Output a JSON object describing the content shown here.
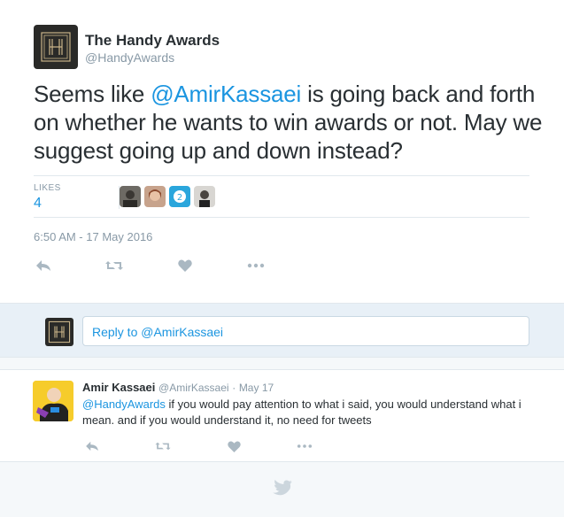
{
  "tweet": {
    "author_name": "The Handy Awards",
    "author_handle": "@HandyAwards",
    "text_before": "Seems like ",
    "text_mention": "@AmirKassaei",
    "text_after": " is going back and forth on whether he wants to win awards or not. May we suggest going up and down instead?",
    "likes_label": "LIKES",
    "likes_count": "4",
    "timestamp": "6:50 AM - 17 May 2016"
  },
  "reply_box": {
    "placeholder": "Reply to @AmirKassaei"
  },
  "reply": {
    "name": "Amir Kassaei",
    "handle": "@AmirKassaei",
    "separator": "·",
    "date": "May 17",
    "mention": "@HandyAwards",
    "text": " if you would pay attention to what i said, you would understand what i mean. and if you would understand it, no need for tweets"
  },
  "icons": {
    "reply": "reply-icon",
    "retweet": "retweet-icon",
    "like": "heart-icon",
    "more": "more-icon",
    "bird": "twitter-bird-icon"
  },
  "colors": {
    "link": "#1b95e0",
    "muted": "#8899a6",
    "icon": "#aab8c2",
    "reply_bg": "#e8f0f7"
  }
}
